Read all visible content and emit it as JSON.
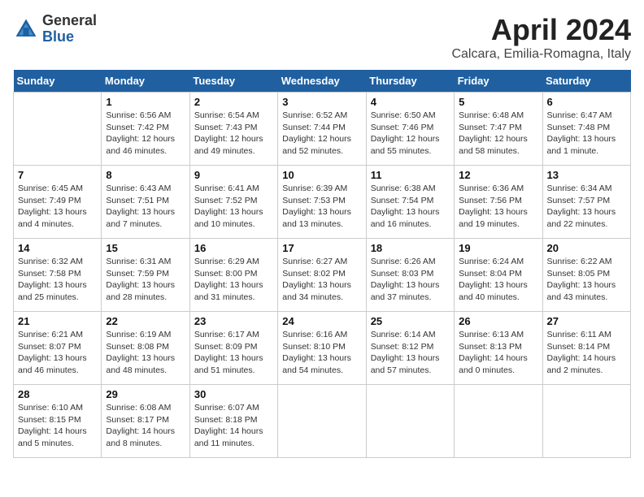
{
  "header": {
    "logo_general": "General",
    "logo_blue": "Blue",
    "month_title": "April 2024",
    "location": "Calcara, Emilia-Romagna, Italy"
  },
  "weekdays": [
    "Sunday",
    "Monday",
    "Tuesday",
    "Wednesday",
    "Thursday",
    "Friday",
    "Saturday"
  ],
  "weeks": [
    [
      {
        "day": "",
        "sunrise": "",
        "sunset": "",
        "daylight": ""
      },
      {
        "day": "1",
        "sunrise": "Sunrise: 6:56 AM",
        "sunset": "Sunset: 7:42 PM",
        "daylight": "Daylight: 12 hours and 46 minutes."
      },
      {
        "day": "2",
        "sunrise": "Sunrise: 6:54 AM",
        "sunset": "Sunset: 7:43 PM",
        "daylight": "Daylight: 12 hours and 49 minutes."
      },
      {
        "day": "3",
        "sunrise": "Sunrise: 6:52 AM",
        "sunset": "Sunset: 7:44 PM",
        "daylight": "Daylight: 12 hours and 52 minutes."
      },
      {
        "day": "4",
        "sunrise": "Sunrise: 6:50 AM",
        "sunset": "Sunset: 7:46 PM",
        "daylight": "Daylight: 12 hours and 55 minutes."
      },
      {
        "day": "5",
        "sunrise": "Sunrise: 6:48 AM",
        "sunset": "Sunset: 7:47 PM",
        "daylight": "Daylight: 12 hours and 58 minutes."
      },
      {
        "day": "6",
        "sunrise": "Sunrise: 6:47 AM",
        "sunset": "Sunset: 7:48 PM",
        "daylight": "Daylight: 13 hours and 1 minute."
      }
    ],
    [
      {
        "day": "7",
        "sunrise": "Sunrise: 6:45 AM",
        "sunset": "Sunset: 7:49 PM",
        "daylight": "Daylight: 13 hours and 4 minutes."
      },
      {
        "day": "8",
        "sunrise": "Sunrise: 6:43 AM",
        "sunset": "Sunset: 7:51 PM",
        "daylight": "Daylight: 13 hours and 7 minutes."
      },
      {
        "day": "9",
        "sunrise": "Sunrise: 6:41 AM",
        "sunset": "Sunset: 7:52 PM",
        "daylight": "Daylight: 13 hours and 10 minutes."
      },
      {
        "day": "10",
        "sunrise": "Sunrise: 6:39 AM",
        "sunset": "Sunset: 7:53 PM",
        "daylight": "Daylight: 13 hours and 13 minutes."
      },
      {
        "day": "11",
        "sunrise": "Sunrise: 6:38 AM",
        "sunset": "Sunset: 7:54 PM",
        "daylight": "Daylight: 13 hours and 16 minutes."
      },
      {
        "day": "12",
        "sunrise": "Sunrise: 6:36 AM",
        "sunset": "Sunset: 7:56 PM",
        "daylight": "Daylight: 13 hours and 19 minutes."
      },
      {
        "day": "13",
        "sunrise": "Sunrise: 6:34 AM",
        "sunset": "Sunset: 7:57 PM",
        "daylight": "Daylight: 13 hours and 22 minutes."
      }
    ],
    [
      {
        "day": "14",
        "sunrise": "Sunrise: 6:32 AM",
        "sunset": "Sunset: 7:58 PM",
        "daylight": "Daylight: 13 hours and 25 minutes."
      },
      {
        "day": "15",
        "sunrise": "Sunrise: 6:31 AM",
        "sunset": "Sunset: 7:59 PM",
        "daylight": "Daylight: 13 hours and 28 minutes."
      },
      {
        "day": "16",
        "sunrise": "Sunrise: 6:29 AM",
        "sunset": "Sunset: 8:00 PM",
        "daylight": "Daylight: 13 hours and 31 minutes."
      },
      {
        "day": "17",
        "sunrise": "Sunrise: 6:27 AM",
        "sunset": "Sunset: 8:02 PM",
        "daylight": "Daylight: 13 hours and 34 minutes."
      },
      {
        "day": "18",
        "sunrise": "Sunrise: 6:26 AM",
        "sunset": "Sunset: 8:03 PM",
        "daylight": "Daylight: 13 hours and 37 minutes."
      },
      {
        "day": "19",
        "sunrise": "Sunrise: 6:24 AM",
        "sunset": "Sunset: 8:04 PM",
        "daylight": "Daylight: 13 hours and 40 minutes."
      },
      {
        "day": "20",
        "sunrise": "Sunrise: 6:22 AM",
        "sunset": "Sunset: 8:05 PM",
        "daylight": "Daylight: 13 hours and 43 minutes."
      }
    ],
    [
      {
        "day": "21",
        "sunrise": "Sunrise: 6:21 AM",
        "sunset": "Sunset: 8:07 PM",
        "daylight": "Daylight: 13 hours and 46 minutes."
      },
      {
        "day": "22",
        "sunrise": "Sunrise: 6:19 AM",
        "sunset": "Sunset: 8:08 PM",
        "daylight": "Daylight: 13 hours and 48 minutes."
      },
      {
        "day": "23",
        "sunrise": "Sunrise: 6:17 AM",
        "sunset": "Sunset: 8:09 PM",
        "daylight": "Daylight: 13 hours and 51 minutes."
      },
      {
        "day": "24",
        "sunrise": "Sunrise: 6:16 AM",
        "sunset": "Sunset: 8:10 PM",
        "daylight": "Daylight: 13 hours and 54 minutes."
      },
      {
        "day": "25",
        "sunrise": "Sunrise: 6:14 AM",
        "sunset": "Sunset: 8:12 PM",
        "daylight": "Daylight: 13 hours and 57 minutes."
      },
      {
        "day": "26",
        "sunrise": "Sunrise: 6:13 AM",
        "sunset": "Sunset: 8:13 PM",
        "daylight": "Daylight: 14 hours and 0 minutes."
      },
      {
        "day": "27",
        "sunrise": "Sunrise: 6:11 AM",
        "sunset": "Sunset: 8:14 PM",
        "daylight": "Daylight: 14 hours and 2 minutes."
      }
    ],
    [
      {
        "day": "28",
        "sunrise": "Sunrise: 6:10 AM",
        "sunset": "Sunset: 8:15 PM",
        "daylight": "Daylight: 14 hours and 5 minutes."
      },
      {
        "day": "29",
        "sunrise": "Sunrise: 6:08 AM",
        "sunset": "Sunset: 8:17 PM",
        "daylight": "Daylight: 14 hours and 8 minutes."
      },
      {
        "day": "30",
        "sunrise": "Sunrise: 6:07 AM",
        "sunset": "Sunset: 8:18 PM",
        "daylight": "Daylight: 14 hours and 11 minutes."
      },
      {
        "day": "",
        "sunrise": "",
        "sunset": "",
        "daylight": ""
      },
      {
        "day": "",
        "sunrise": "",
        "sunset": "",
        "daylight": ""
      },
      {
        "day": "",
        "sunrise": "",
        "sunset": "",
        "daylight": ""
      },
      {
        "day": "",
        "sunrise": "",
        "sunset": "",
        "daylight": ""
      }
    ]
  ]
}
